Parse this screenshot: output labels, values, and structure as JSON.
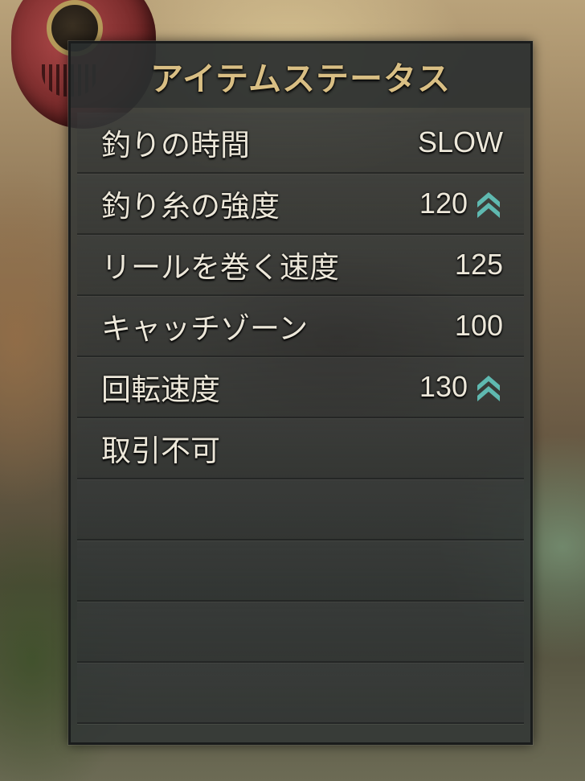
{
  "title": "アイテムステータス",
  "stats": [
    {
      "label": "釣りの時間",
      "value": "SLOW",
      "upgrade": false
    },
    {
      "label": "釣り糸の強度",
      "value": "120",
      "upgrade": true
    },
    {
      "label": "リールを巻く速度",
      "value": "125",
      "upgrade": false
    },
    {
      "label": "キャッチゾーン",
      "value": "100",
      "upgrade": false
    },
    {
      "label": "回転速度",
      "value": "130",
      "upgrade": true
    },
    {
      "label": "取引不可",
      "value": "",
      "upgrade": false
    }
  ],
  "empty_rows": 4,
  "colors": {
    "title": "#d9bf84",
    "text": "#ece7d9",
    "upgrade_icon": "#5fb9b0"
  },
  "icons": {
    "upgrade": "double-chevron-up-icon"
  }
}
